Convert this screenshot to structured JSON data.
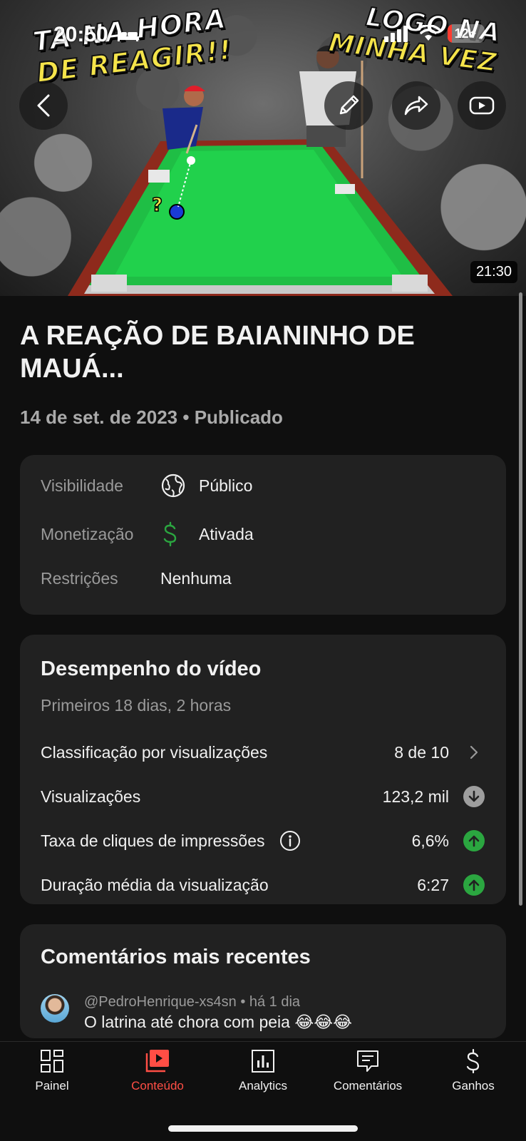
{
  "status_bar": {
    "time": "20:50",
    "battery": "12",
    "battery_level": 0.12
  },
  "thumbnail": {
    "text_left_line1": "TA NA HORA",
    "text_left_line2": "DE REAGIR!!",
    "text_right_line1": "LOGO NA",
    "text_right_line2": "MINHA VEZ",
    "duration": "21:30"
  },
  "video": {
    "title": "A REAÇÃO DE BAIANINHO DE MAUÁ...",
    "date_status": "14 de set. de 2023 • Publicado"
  },
  "details": {
    "visibility_label": "Visibilidade",
    "visibility_value": "Público",
    "monetization_label": "Monetização",
    "monetization_value": "Ativada",
    "restrictions_label": "Restrições",
    "restrictions_value": "Nenhuma"
  },
  "performance": {
    "title": "Desempenho do vídeo",
    "subtitle": "Primeiros 18 dias, 2 horas",
    "ranking_label": "Classificação por visualizações",
    "ranking_value": "8 de 10",
    "views_label": "Visualizações",
    "views_value": "123,2 mil",
    "ctr_label": "Taxa de cliques de impressões",
    "ctr_value": "6,6%",
    "avg_duration_label": "Duração média da visualização",
    "avg_duration_value": "6:27",
    "colors": {
      "up": "#2ba640",
      "down": "#9e9e9e"
    }
  },
  "comments": {
    "title": "Comentários mais recentes",
    "items": [
      {
        "author": "@PedroHenrique-xs4sn",
        "time": "há 1 dia",
        "text": "O latrina até chora com peia 😂😂😂"
      }
    ]
  },
  "nav": {
    "items": [
      {
        "label": "Painel",
        "icon": "dashboard-icon"
      },
      {
        "label": "Conteúdo",
        "icon": "content-icon"
      },
      {
        "label": "Analytics",
        "icon": "analytics-icon"
      },
      {
        "label": "Comentários",
        "icon": "comments-icon"
      },
      {
        "label": "Ganhos",
        "icon": "earnings-icon"
      }
    ],
    "active_color": "#ff4e45"
  }
}
